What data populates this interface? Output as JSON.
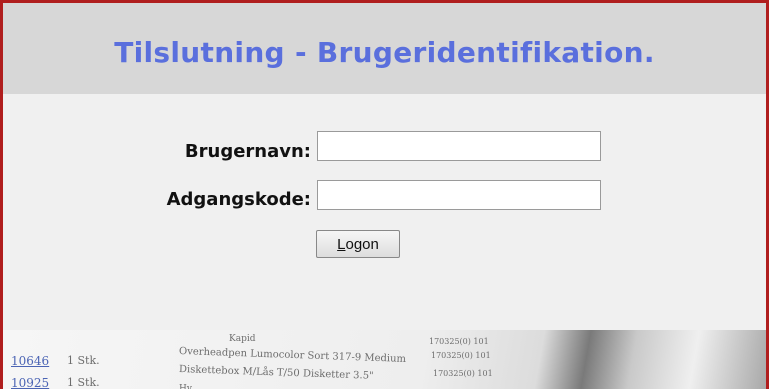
{
  "header": {
    "title": "Tilslutning - Brugeridentifikation."
  },
  "form": {
    "username_label": "Brugernavn:",
    "username_value": "",
    "password_label": "Adgangskode:",
    "password_value": "",
    "logon_access_key": "L",
    "logon_rest": "ogon"
  },
  "background_photo": {
    "rows": [
      {
        "code": "10646",
        "qty": "1 Stk.",
        "desc": "Overheadpen Lumocolor Sort 317-9 Medium",
        "ref": "170325(0) 101"
      },
      {
        "code": "10925",
        "qty": "1 Stk.",
        "desc": "Diskettebox M/Lås T/50 Disketter 3.5\"",
        "ref": "170325(0) 101"
      }
    ],
    "top_fragment": "Kapid",
    "top_ref": "170325(0) 101",
    "bottom_fragment": "Hy"
  },
  "colors": {
    "title": "#5a6fdd",
    "frame_border": "#b01e1e",
    "header_bg": "#d7d7d7",
    "page_bg": "#f0f0f0"
  }
}
